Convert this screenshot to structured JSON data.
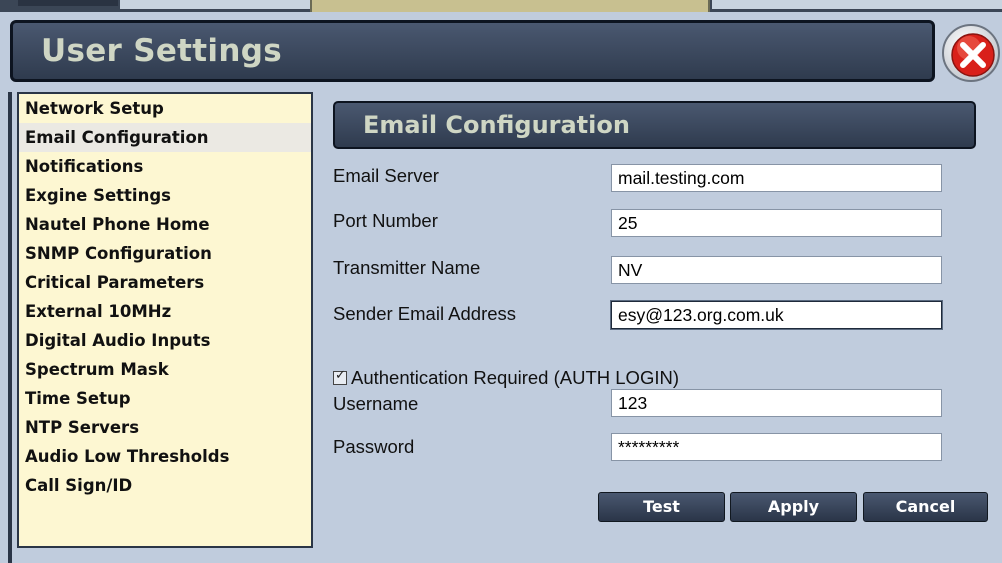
{
  "window": {
    "title": "User Settings"
  },
  "sidebar": {
    "items": [
      {
        "label": "Network Setup"
      },
      {
        "label": "Email Configuration"
      },
      {
        "label": "Notifications"
      },
      {
        "label": "Exgine Settings"
      },
      {
        "label": "Nautel Phone Home"
      },
      {
        "label": "SNMP Configuration"
      },
      {
        "label": "Critical Parameters"
      },
      {
        "label": "External 10MHz"
      },
      {
        "label": "Digital Audio Inputs"
      },
      {
        "label": "Spectrum Mask"
      },
      {
        "label": "Time Setup"
      },
      {
        "label": "NTP Servers"
      },
      {
        "label": "Audio Low Thresholds"
      },
      {
        "label": "Call Sign/ID"
      }
    ],
    "selected": "Email Configuration"
  },
  "panel": {
    "title": "Email Configuration",
    "fields": {
      "email_server": {
        "label": "Email Server",
        "value": "mail.testing.com"
      },
      "port_number": {
        "label": "Port Number",
        "value": "25"
      },
      "transmitter_name": {
        "label": "Transmitter Name",
        "value": "NV"
      },
      "sender_email": {
        "label": "Sender Email Address",
        "value": "esy@123.org.com.uk"
      },
      "username": {
        "label": "Username",
        "value": "123"
      },
      "password": {
        "label": "Password",
        "value": "*********"
      }
    },
    "auth": {
      "label": "Authentication Required (AUTH LOGIN)",
      "checked": true
    },
    "buttons": {
      "test": "Test",
      "apply": "Apply",
      "cancel": "Cancel"
    }
  },
  "icons": {
    "close": "close-icon"
  },
  "colors": {
    "close_red": "#e0231c",
    "sidebar_bg": "#fdf7d2",
    "header_bg": "#3a475c"
  }
}
